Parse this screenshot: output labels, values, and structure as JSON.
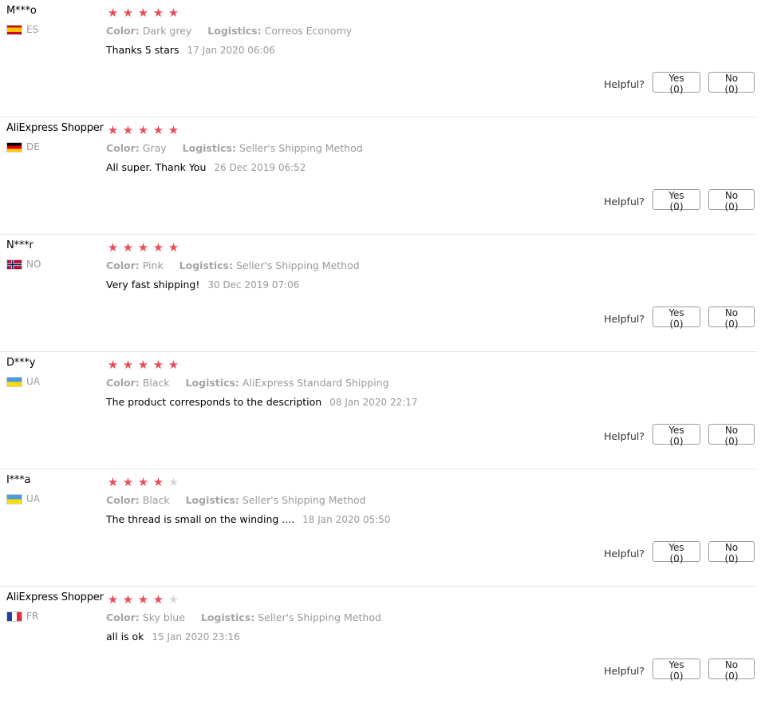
{
  "labels": {
    "color": "Color:",
    "logistics": "Logistics:",
    "helpful": "Helpful?"
  },
  "colors": {
    "star_filled": "#e94d5a",
    "star_empty": "#d8d8d8"
  },
  "reviews": [
    {
      "user": "M***o",
      "country": "ES",
      "flag": "flag-es-icon",
      "rating": 5,
      "color": "Dark grey",
      "logistics": "Correos Economy",
      "text": "Thanks 5 stars",
      "date": "17 Jan 2020 06:06",
      "yes": "Yes (0)",
      "no": "No (0)"
    },
    {
      "user": "AliExpress Shopper",
      "country": "DE",
      "flag": "flag-de-icon",
      "rating": 5,
      "color": "Gray",
      "logistics": "Seller's Shipping Method",
      "text": "All super. Thank You",
      "date": "26 Dec 2019 06:52",
      "yes": "Yes (0)",
      "no": "No (0)"
    },
    {
      "user": "N***r",
      "country": "NO",
      "flag": "flag-no-icon",
      "rating": 5,
      "color": "Pink",
      "logistics": "Seller's Shipping Method",
      "text": "Very fast shipping!",
      "date": "30 Dec 2019 07:06",
      "yes": "Yes (0)",
      "no": "No (0)"
    },
    {
      "user": "D***y",
      "country": "UA",
      "flag": "flag-ua-icon",
      "rating": 5,
      "color": "Black",
      "logistics": "AliExpress Standard Shipping",
      "text": "The product corresponds to the description",
      "date": "08 Jan 2020 22:17",
      "yes": "Yes (0)",
      "no": "No (0)"
    },
    {
      "user": "I***a",
      "country": "UA",
      "flag": "flag-ua-icon",
      "rating": 4,
      "color": "Black",
      "logistics": "Seller's Shipping Method",
      "text": "The thread is small on the winding ....",
      "date": "18 Jan 2020 05:50",
      "yes": "Yes (0)",
      "no": "No (0)"
    },
    {
      "user": "AliExpress Shopper",
      "country": "FR",
      "flag": "flag-fr-icon",
      "rating": 4,
      "color": "Sky blue",
      "logistics": "Seller's Shipping Method",
      "text": "all is ok",
      "date": "15 Jan 2020 23:16",
      "yes": "Yes (0)",
      "no": "No (0)"
    }
  ]
}
